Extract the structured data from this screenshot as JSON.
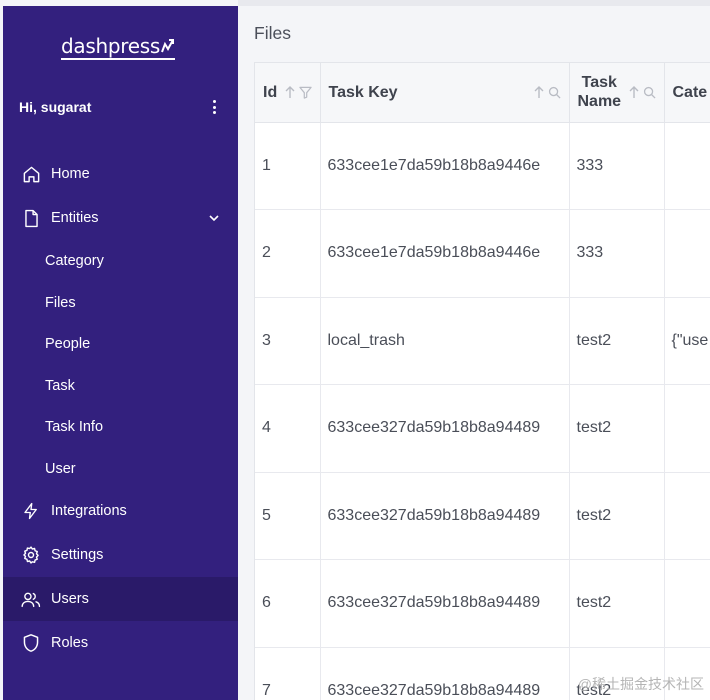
{
  "brand": {
    "name": "dashpress"
  },
  "user": {
    "greeting": "Hi, sugarat"
  },
  "nav": {
    "home": "Home",
    "entities": "Entities",
    "entities_children": [
      "Category",
      "Files",
      "People",
      "Task",
      "Task Info",
      "User"
    ],
    "integrations": "Integrations",
    "settings": "Settings",
    "users": "Users",
    "roles": "Roles"
  },
  "page": {
    "title": "Files"
  },
  "table": {
    "columns": [
      "Id",
      "Task Key",
      "Task Name",
      "Cate"
    ],
    "column_task_name_lines": [
      "Task",
      "Name"
    ],
    "rows": [
      [
        "1",
        "633cee1e7da59b18b8a9446e",
        "333",
        ""
      ],
      [
        "2",
        "633cee1e7da59b18b8a9446e",
        "333",
        ""
      ],
      [
        "3",
        "local_trash",
        "test2",
        "{\"use"
      ],
      [
        "4",
        "633cee327da59b18b8a94489",
        "test2",
        ""
      ],
      [
        "5",
        "633cee327da59b18b8a94489",
        "test2",
        ""
      ],
      [
        "6",
        "633cee327da59b18b8a94489",
        "test2",
        ""
      ],
      [
        "7",
        "633cee327da59b18b8a94489",
        "test2",
        ""
      ]
    ]
  },
  "watermark": "@稀土掘金技术社区",
  "colors": {
    "sidebar": "#33207e",
    "sidebar_active": "#2a1a69",
    "header_bg": "#f6f7f9"
  }
}
